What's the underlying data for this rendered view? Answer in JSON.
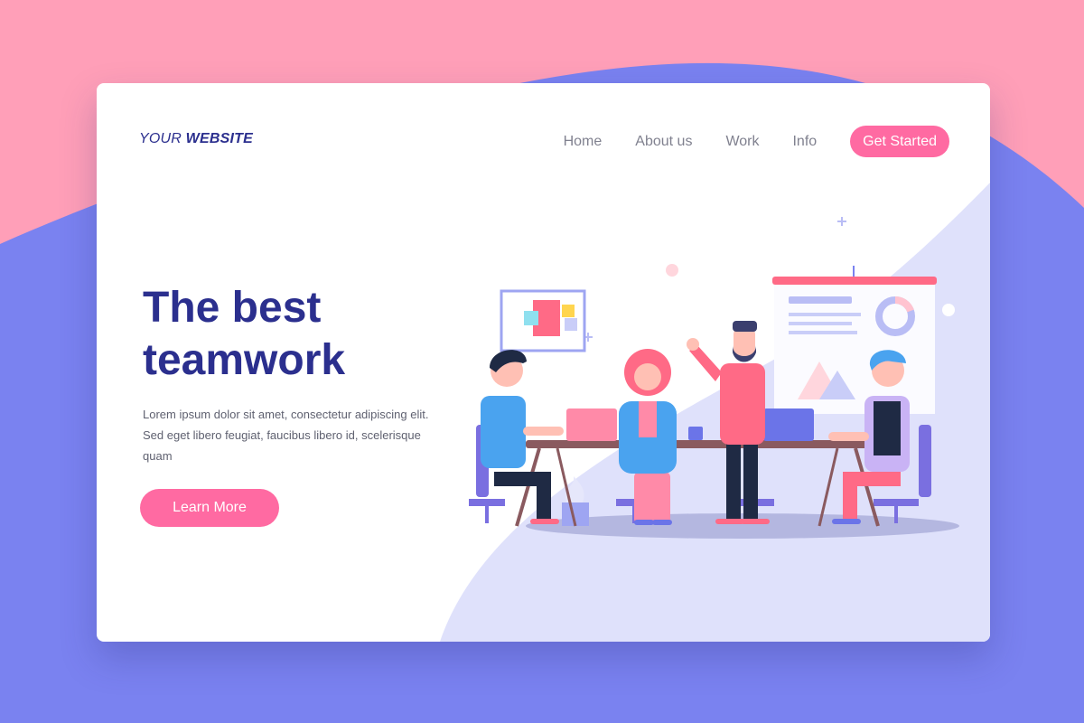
{
  "brand": {
    "logo_light": "YOUR ",
    "logo_bold": "WEBSITE"
  },
  "nav": {
    "links": [
      "Home",
      "About us",
      "Work",
      "Info"
    ],
    "cta_label": "Get Started"
  },
  "hero": {
    "title": "The best teamwork",
    "description": "Lorem ipsum dolor sit amet, consectetur adipiscing elit. Sed eget libero feugiat, faucibus libero id, scelerisque quam",
    "button_label": "Learn More"
  },
  "colors": {
    "background_pink": "#ff9fb8",
    "background_blue": "#7a82f0",
    "brand_navy": "#2b2f8e",
    "accent_pink": "#ff6aa2",
    "card_blob": "#dfe1fb"
  },
  "icons": {
    "illustration": "team-meeting-illustration"
  }
}
